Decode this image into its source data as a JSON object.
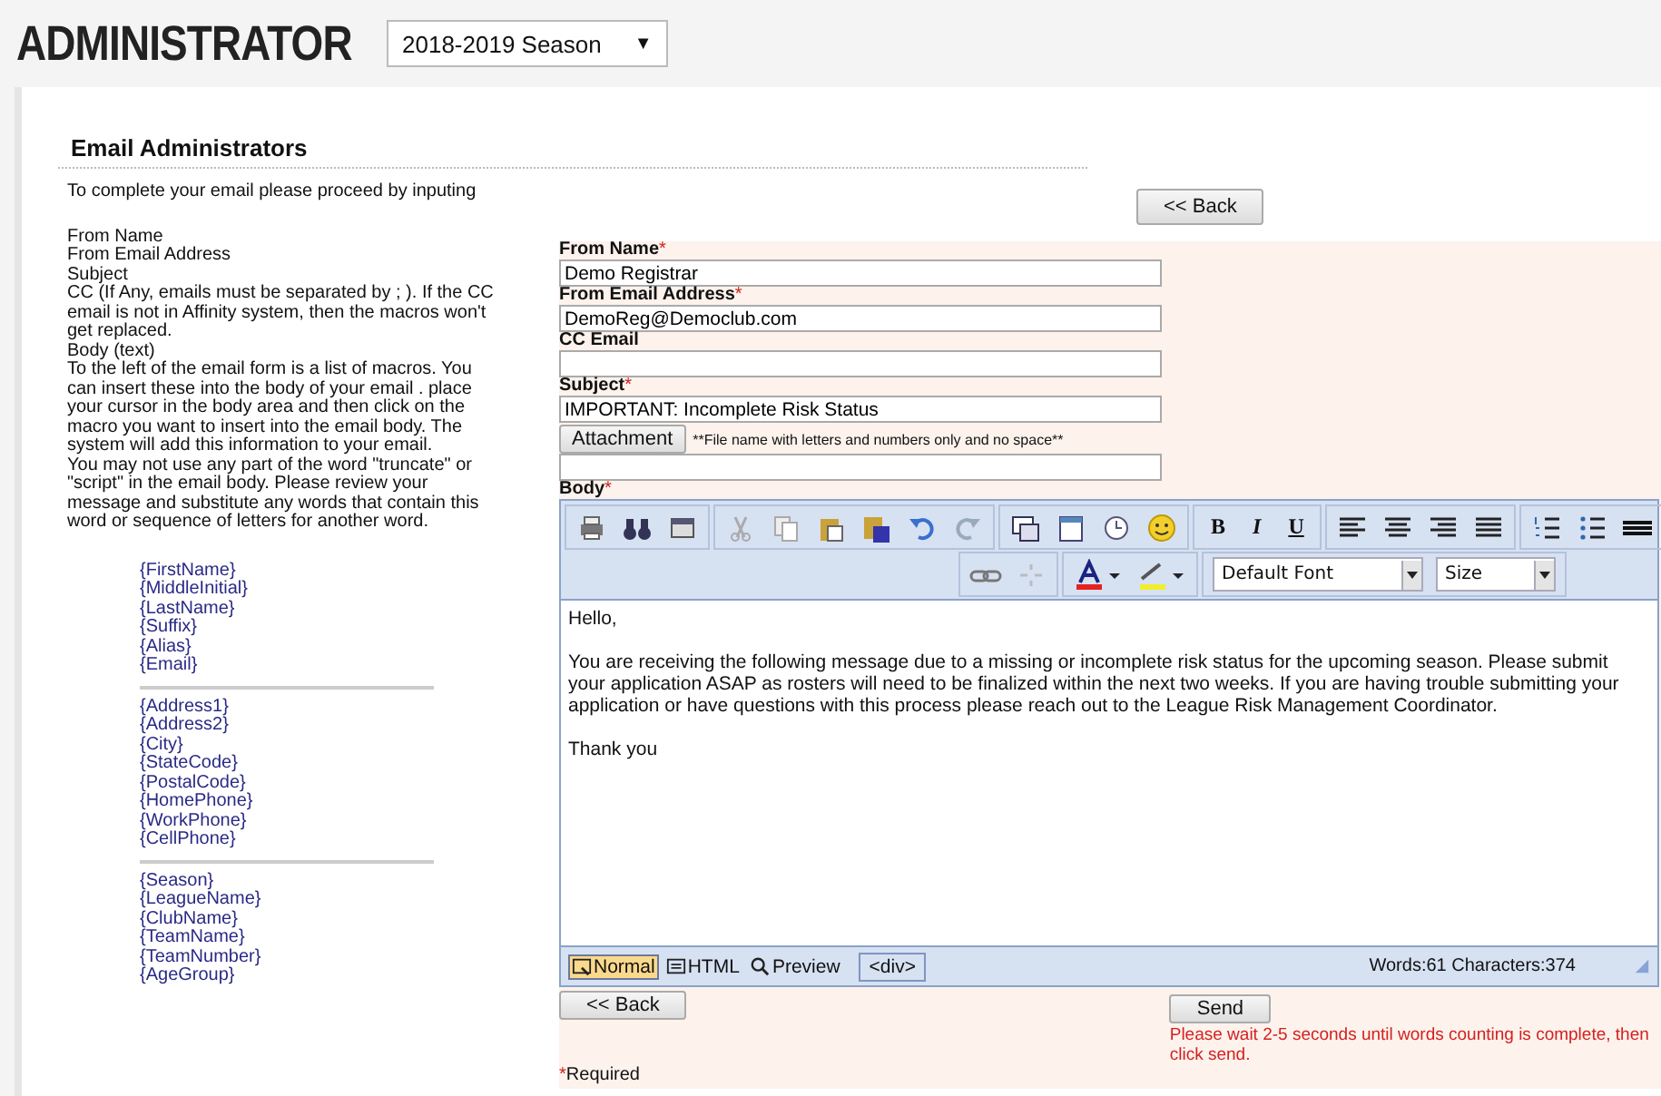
{
  "header": {
    "title": "ADMINISTRATOR",
    "season_select": "2018-2019 Season",
    "caret": "▼"
  },
  "section_title": "Email Administrators",
  "instructions": {
    "intro": "To complete your email please proceed by inputing",
    "lines": [
      "From Name",
      "From Email Address",
      "Subject",
      "CC (If Any, emails must be separated by ; ). If the CC email is not in Affinity system, then the macros won't get replaced.",
      "Body (text)",
      "To the left of the email form is a list of macros. You can insert these into the body of your email . place your cursor in the body area and then click on the macro you want to insert into the email body. The system will add this information to your email.",
      "You may not use any part of the word \"truncate\" or \"script\" in the email body. Please review your message and substitute any words that contain this word or sequence of letters for another word."
    ]
  },
  "macro_groups": [
    [
      "{FirstName}",
      "{MiddleInitial}",
      "{LastName}",
      "{Suffix}",
      "{Alias}",
      "{Email}"
    ],
    [
      "{Address1}",
      "{Address2}",
      "{City}",
      "{StateCode}",
      "{PostalCode}",
      "{HomePhone}",
      "{WorkPhone}",
      "{CellPhone}"
    ],
    [
      "{Season}",
      "{LeagueName}",
      "{ClubName}",
      "{TeamName}",
      "{TeamNumber}",
      "{AgeGroup}"
    ]
  ],
  "back_button": "<< Back",
  "form": {
    "fields": [
      {
        "label": "From Name",
        "required_mark": "*",
        "value": "Demo Registrar"
      },
      {
        "label": "From Email Address",
        "required_mark": "*",
        "value": "DemoReg@Democlub.com"
      },
      {
        "label": "CC Email"
      },
      {
        "label": "Subject",
        "required_mark": "*",
        "value": "IMPORTANT: Incomplete Risk Status"
      }
    ],
    "attachment_button": "Attachment",
    "attachment_note": "**File name with letters and numbers only and no space**",
    "body_label": "Body",
    "body_required_mark": "*"
  },
  "editor": {
    "format_buttons": [
      "B",
      "I",
      "U"
    ],
    "font_select": "Default Font",
    "size_select": "Size",
    "body": [
      "Hello,",
      "You are receiving the following message due to a missing or incomplete risk status for the upcoming season. Please submit your application ASAP as rosters will need to be finalized within the next two weeks. If you are having trouble submitting your application or have questions with this process please reach out to the League Risk Management Coordinator.",
      "Thank you"
    ],
    "modes": [
      {
        "label": "Normal",
        "kind": "normal",
        "selected": true
      },
      {
        "label": "HTML",
        "kind": "html",
        "selected": false
      },
      {
        "label": "Preview",
        "kind": "preview",
        "selected": false
      }
    ],
    "tag_path": "<div>",
    "counts": "Words:61 Characters:374"
  },
  "bottom_back_button": "<< Back",
  "send_button": "Send",
  "send_warning": "Please wait 2-5 seconds until words counting is complete, then click send.",
  "required_note": {
    "mark": "*",
    "text": "Required"
  }
}
